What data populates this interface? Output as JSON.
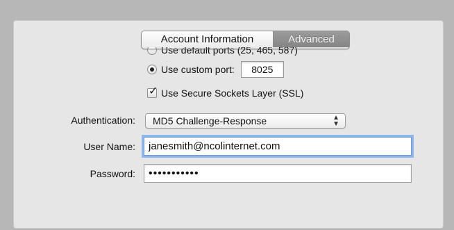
{
  "tabs": {
    "account_information": "Account Information",
    "advanced": "Advanced"
  },
  "ports": {
    "default_ports_label": "Use default ports (25, 465, 587)",
    "custom_port_label": "Use custom port:",
    "custom_port_value": "8025",
    "selected": "custom"
  },
  "ssl": {
    "label": "Use Secure Sockets Layer (SSL)",
    "checked": true
  },
  "authentication": {
    "label": "Authentication:",
    "value": "MD5 Challenge-Response"
  },
  "user_name": {
    "label": "User Name:",
    "value": "janesmith@ncolinternet.com"
  },
  "password": {
    "label": "Password:",
    "value": "•••••••••••"
  },
  "colors": {
    "panel_bg": "#e6e6e6",
    "tab_active_bg": "#8f8f8f",
    "focus_ring": "#8fb8ea"
  }
}
